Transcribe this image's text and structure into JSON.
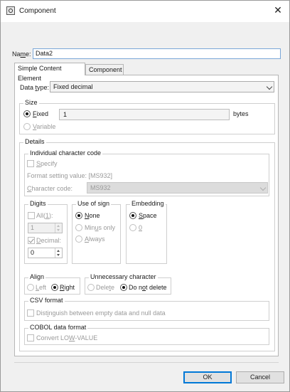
{
  "window": {
    "title": "Component"
  },
  "name": {
    "label_pre": "Na",
    "label_u": "m",
    "label_post": "e:",
    "value": "Data2"
  },
  "tabs": [
    {
      "label": "Simple Content Element"
    },
    {
      "label": "Component"
    }
  ],
  "data_type": {
    "label_pre": "Data ",
    "label_u": "t",
    "label_post": "ype:",
    "value": "Fixed decimal"
  },
  "size": {
    "title": "Size",
    "fixed_u": "F",
    "fixed_rest": "ixed",
    "fixed_value": "1",
    "unit": "bytes",
    "variable_u": "V",
    "variable_rest": "ariable"
  },
  "details": {
    "title": "Details",
    "icc": {
      "title": "Individual character code",
      "specify_u": "S",
      "specify_rest": "pecify",
      "format_label": "Format setting value: [MS932]",
      "char_code_u": "C",
      "char_code_rest": "haracter code:",
      "char_code_value": "MS932"
    },
    "digits": {
      "title": "Digits",
      "all_pre": "All(",
      "all_u": "1",
      "all_post": "):",
      "all_value": "1",
      "decimal_u": "D",
      "decimal_rest": "ecimal:",
      "decimal_value": "0"
    },
    "sign": {
      "title": "Use of sign",
      "none_u": "N",
      "none_rest": "one",
      "minus_pre": "Min",
      "minus_u": "u",
      "minus_post": "s only",
      "always_u": "A",
      "always_rest": "lways"
    },
    "embedding": {
      "title": "Embedding",
      "space_u": "S",
      "space_rest": "pace",
      "zero_u": "0"
    },
    "align": {
      "title": "Align",
      "left_u": "L",
      "left_rest": "eft",
      "right_u": "R",
      "right_rest": "ight"
    },
    "unnecessary": {
      "title": "Unnecessary character",
      "delete_pre": "Dele",
      "delete_u": "t",
      "delete_post": "e",
      "not_pre": "Do n",
      "not_u": "o",
      "not_post": "t delete"
    },
    "csv": {
      "title": "CSV format",
      "distinguish_pre": "Dist",
      "distinguish_u": "i",
      "distinguish_post": "nguish between empty data and null data"
    },
    "cobol": {
      "title": "COBOL data format",
      "convert_pre": "Convert LO",
      "convert_u": "W",
      "convert_post": "-VALUE"
    }
  },
  "buttons": {
    "ok": "OK",
    "cancel": "Cancel"
  }
}
